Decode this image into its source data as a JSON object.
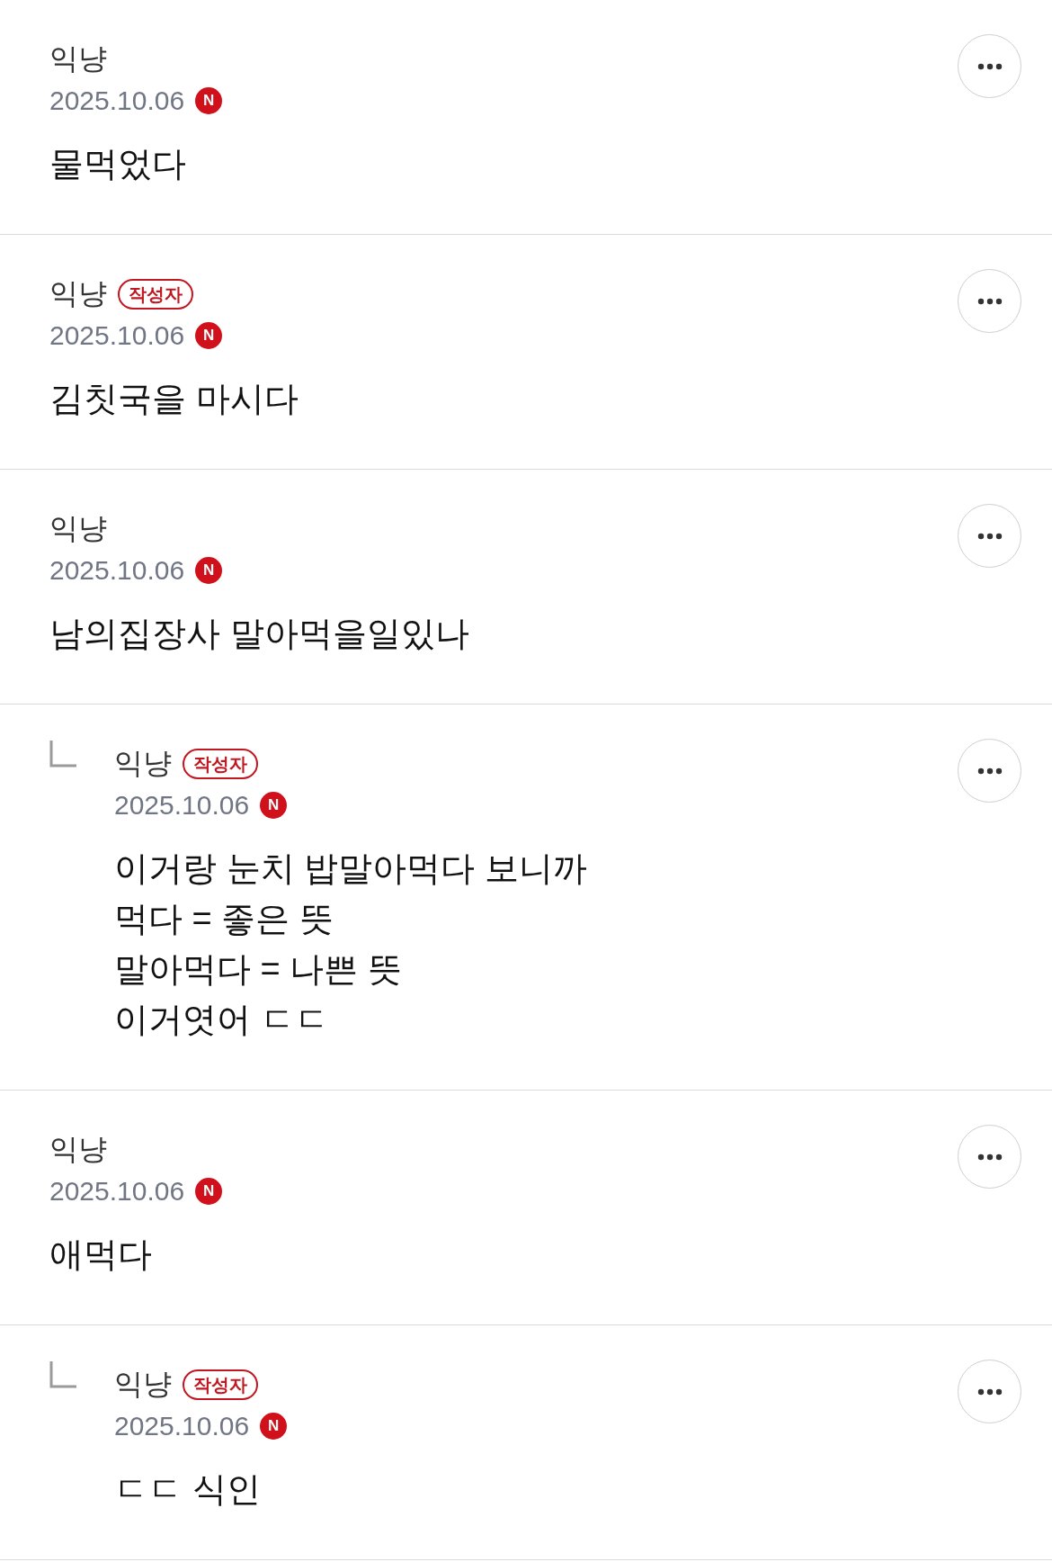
{
  "comments": [
    {
      "kind": "comment",
      "author": "익냥",
      "date": "2025.10.06",
      "new_mark": "N",
      "body": [
        "물먹었다"
      ]
    },
    {
      "kind": "comment",
      "author": "익냥",
      "badge": "작성자",
      "date": "2025.10.06",
      "new_mark": "N",
      "body": [
        "김칫국을 마시다"
      ]
    },
    {
      "kind": "comment",
      "author": "익냥",
      "date": "2025.10.06",
      "new_mark": "N",
      "body": [
        "남의집장사 말아먹을일있나"
      ]
    },
    {
      "kind": "reply",
      "author": "익냥",
      "badge": "작성자",
      "date": "2025.10.06",
      "new_mark": "N",
      "body": [
        "이거랑 눈치 밥말아먹다 보니까",
        "먹다 = 좋은 뜻",
        "말아먹다 = 나쁜 뜻",
        "이거엿어 ㄷㄷ"
      ]
    },
    {
      "kind": "comment",
      "author": "익냥",
      "date": "2025.10.06",
      "new_mark": "N",
      "body": [
        "애먹다"
      ]
    },
    {
      "kind": "reply",
      "author": "익냥",
      "badge": "작성자",
      "date": "2025.10.06",
      "new_mark": "N",
      "body": [
        "ㄷㄷ 식인"
      ]
    }
  ]
}
